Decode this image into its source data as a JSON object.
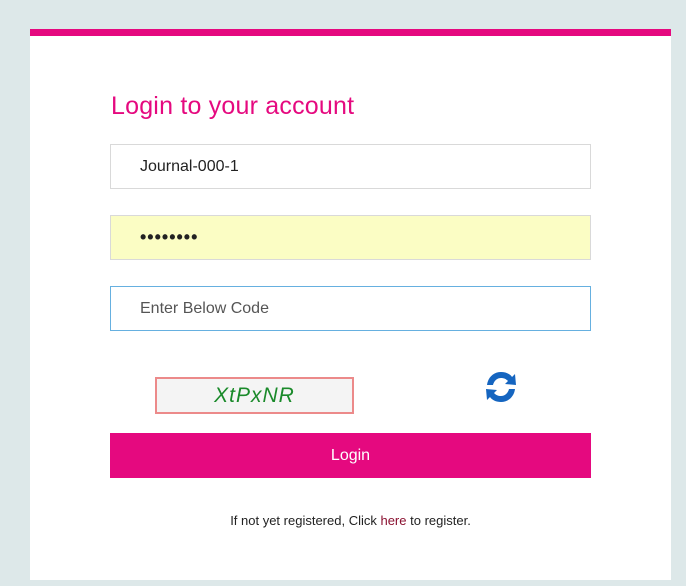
{
  "login": {
    "title": "Login to your account",
    "username_value": "Journal-000-1",
    "password_value": "••••••••",
    "captcha_placeholder": "Enter Below Code",
    "captcha_code": "XtPxNR",
    "refresh_icon": "refresh-icon",
    "login_label": "Login",
    "register_prefix": "If not yet registered, Click ",
    "register_link": "here",
    "register_suffix": " to register."
  },
  "colors": {
    "accent": "#e5097f",
    "refresh_blue": "#1565c0",
    "captcha_text": "#1a8a2a",
    "password_fill": "#fbfdc4",
    "focus_border": "#66b0e0"
  }
}
